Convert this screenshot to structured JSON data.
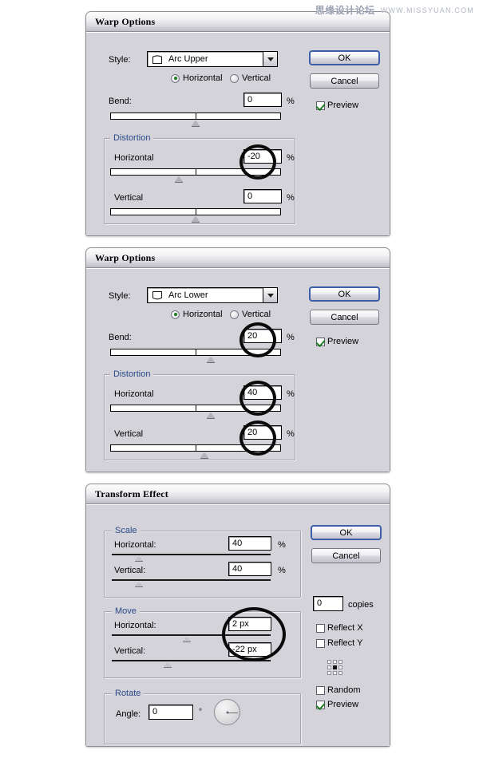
{
  "watermark": {
    "cn": "思缘设计论坛",
    "url": "WWW.MISSYUAN.COM"
  },
  "common": {
    "ok": "OK",
    "cancel": "Cancel",
    "preview": "Preview",
    "horizontal": "Horizontal",
    "vertical": "Vertical",
    "percent": "%",
    "style_label": "Style:",
    "bend_label": "Bend:",
    "distortion_label": "Distortion"
  },
  "dialog1": {
    "title": "Warp Options",
    "style_value": "Arc Upper",
    "style_icon": "arc-upper-glyph",
    "orientation_selected": "Horizontal",
    "bend_value": "0",
    "bend_slider_percent": 50,
    "distortion_horizontal_value": "-20",
    "distortion_horizontal_slider_percent": 40,
    "distortion_vertical_value": "0",
    "distortion_vertical_slider_percent": 50,
    "preview_checked": true,
    "highlighted_field": "distortion_horizontal"
  },
  "dialog2": {
    "title": "Warp Options",
    "style_value": "Arc Lower",
    "style_icon": "arc-lower-glyph",
    "orientation_selected": "Horizontal",
    "bend_value": "20",
    "bend_slider_percent": 59,
    "distortion_horizontal_value": "40",
    "distortion_horizontal_slider_percent": 59,
    "distortion_vertical_value": "20",
    "distortion_vertical_slider_percent": 55,
    "preview_checked": true,
    "highlighted_fields": [
      "bend",
      "distortion_horizontal",
      "distortion_vertical"
    ]
  },
  "dialog3": {
    "title": "Transform Effect",
    "scale_group": "Scale",
    "scale_horizontal_label": "Horizontal:",
    "scale_horizontal_value": "40",
    "scale_horizontal_slider_percent": 17,
    "scale_vertical_label": "Vertical:",
    "scale_vertical_value": "40",
    "scale_vertical_slider_percent": 17,
    "move_group": "Move",
    "move_horizontal_label": "Horizontal:",
    "move_horizontal_value": "2 px",
    "move_horizontal_slider_percent": 47,
    "move_vertical_label": "Vertical:",
    "move_vertical_value": "-22 px",
    "move_vertical_slider_percent": 35,
    "rotate_group": "Rotate",
    "angle_label": "Angle:",
    "angle_value": "0",
    "degree_symbol": "°",
    "copies_value": "0",
    "copies_label": "copies",
    "reflect_x_label": "Reflect X",
    "reflect_x_checked": false,
    "reflect_y_label": "Reflect Y",
    "reflect_y_checked": false,
    "random_label": "Random",
    "random_checked": false,
    "preview_label": "Preview",
    "preview_checked": true,
    "anchor_widget": "reference-point-selector",
    "highlighted_fields": [
      "move_horizontal",
      "move_vertical"
    ]
  },
  "colors": {
    "dialog_face": "#d4d3d9",
    "group_title": "#2b4a8b",
    "default_button_border": "#3b5fa8",
    "check_mark": "#1f7d1f",
    "annotation": "#0a0a0a"
  }
}
